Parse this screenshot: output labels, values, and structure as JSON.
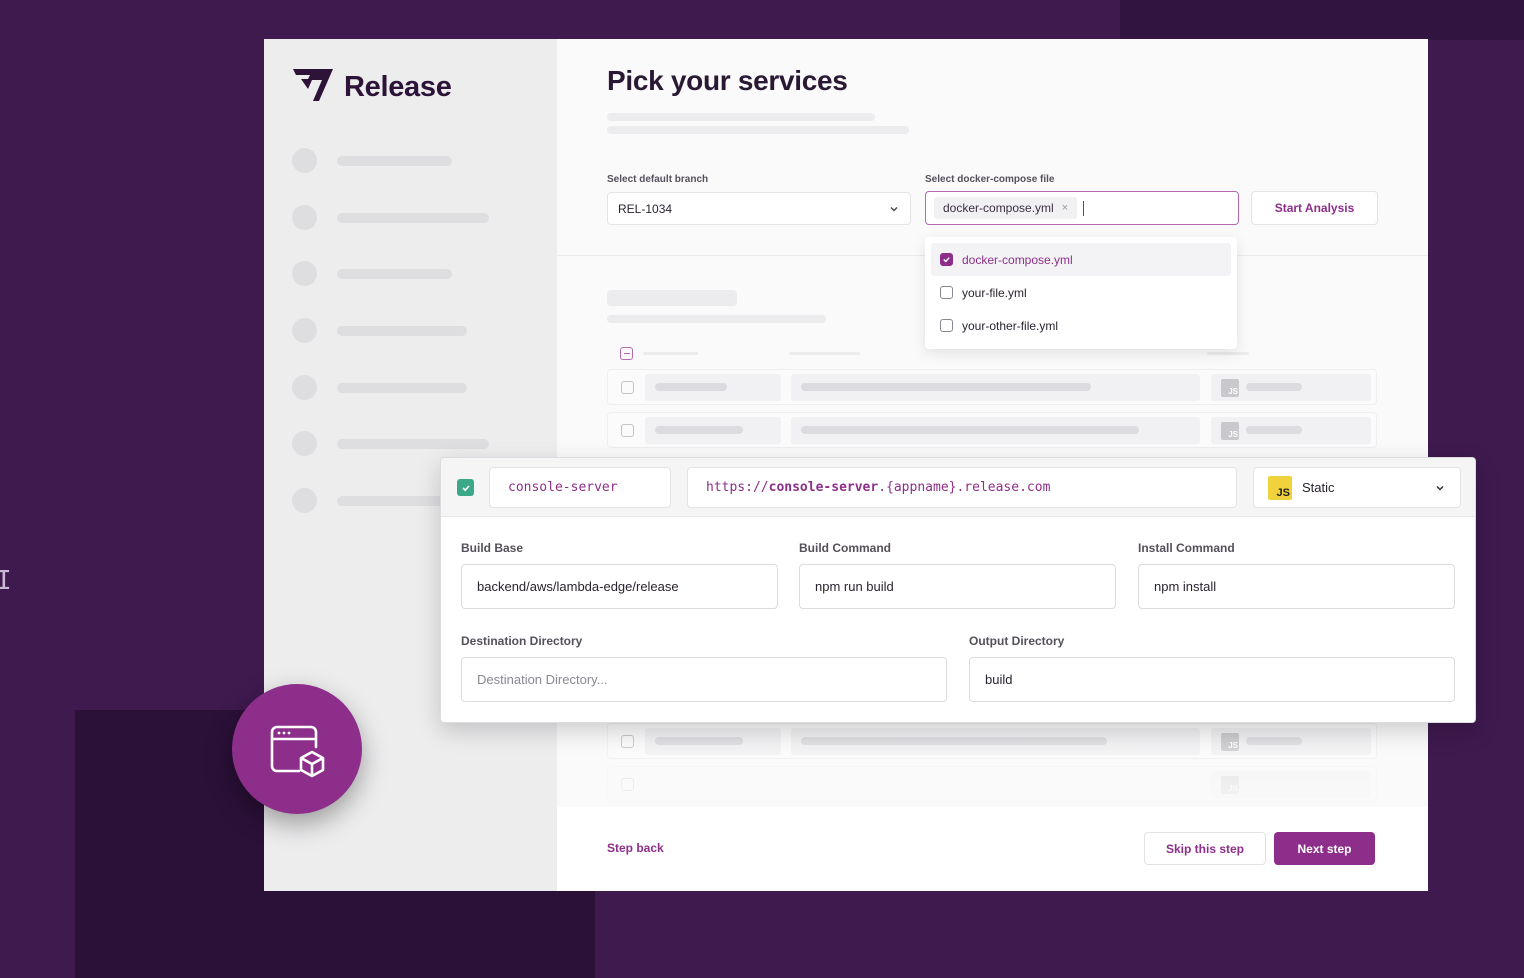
{
  "app": {
    "logo_text": "Release"
  },
  "main": {
    "title": "Pick your services",
    "branch": {
      "label": "Select default branch",
      "value": "REL-1034"
    },
    "compose": {
      "label": "Select docker-compose file",
      "chip": "docker-compose.yml",
      "remove_symbol": "×"
    },
    "start_analysis": "Start Analysis",
    "dropdown": [
      {
        "label": "docker-compose.yml",
        "checked": true
      },
      {
        "label": "your-file.yml",
        "checked": false
      },
      {
        "label": "your-other-file.yml",
        "checked": false
      }
    ],
    "row_badge": "JS"
  },
  "service": {
    "name": "console-server",
    "url_prefix": "https://",
    "url_host": "console-server",
    "url_suffix": ".{appname}.release.com",
    "type_badge": "JS",
    "type": "Static",
    "build_base_label": "Build Base",
    "build_base": "backend/aws/lambda-edge/release",
    "build_command_label": "Build Command",
    "build_command": "npm run build",
    "install_command_label": "Install Command",
    "install_command": "npm install",
    "destination_label": "Destination Directory",
    "destination_placeholder": "Destination Directory...",
    "output_label": "Output Directory",
    "output": "build"
  },
  "footer": {
    "step_back": "Step back",
    "skip": "Skip this step",
    "next": "Next step"
  },
  "colors": {
    "accent": "#8d2f8a",
    "background": "#3e1a4f",
    "success": "#3aa889",
    "js_yellow": "#f0d23c"
  },
  "icons": {
    "logo": "release-logo-icon",
    "hero": "window-cube-icon",
    "bg_glyph": "I"
  }
}
